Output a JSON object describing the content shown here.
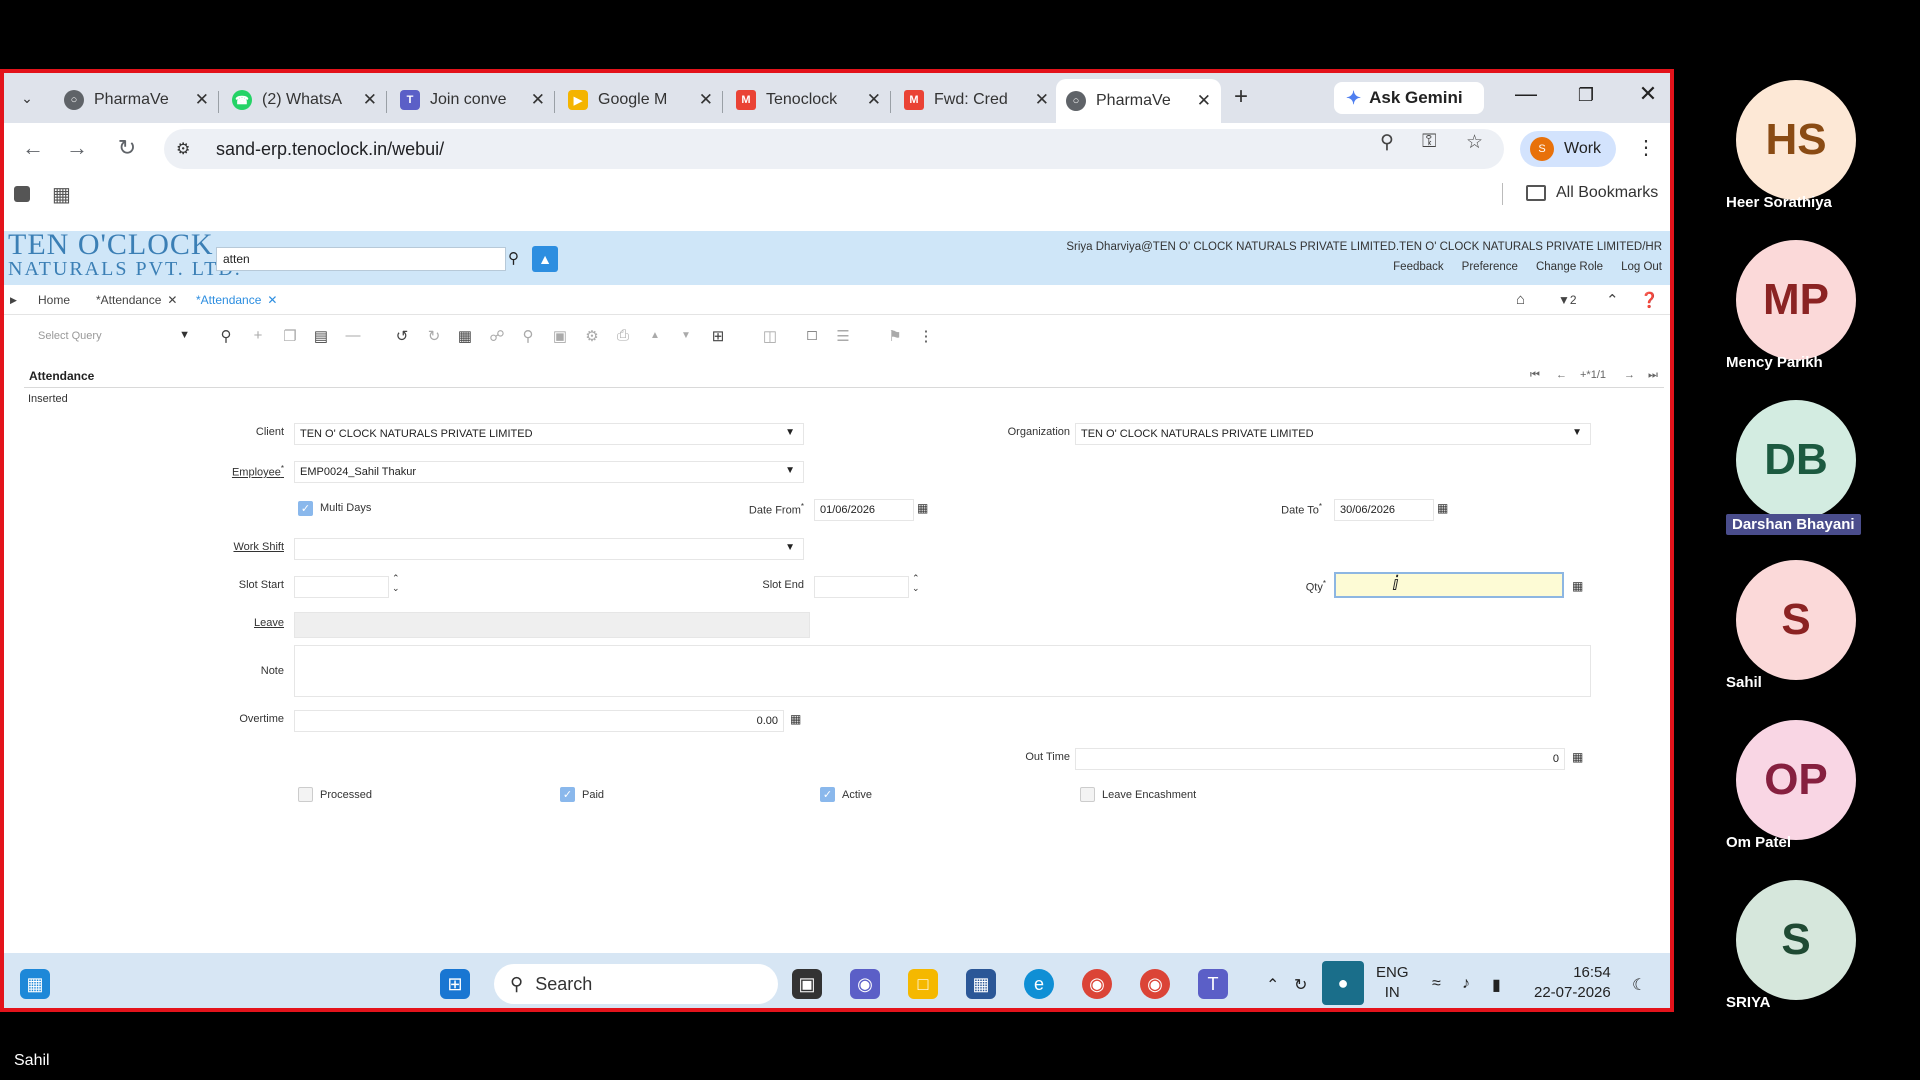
{
  "browser": {
    "tabs": [
      {
        "label": "PharmaVe",
        "icon": "globe-icon",
        "color": "#5f6368",
        "active": false
      },
      {
        "label": "(2) WhatsA",
        "icon": "whatsapp-icon",
        "color": "#25d366",
        "active": false
      },
      {
        "label": "Join conve",
        "icon": "teams-icon",
        "color": "#5b5fc7",
        "active": false
      },
      {
        "label": "Google M",
        "icon": "meet-icon",
        "color": "#f4b400",
        "active": false
      },
      {
        "label": "Tenoclock",
        "icon": "gmail-icon",
        "color": "#ea4335",
        "active": false
      },
      {
        "label": "Fwd: Cred",
        "icon": "gmail-icon",
        "color": "#ea4335",
        "active": false
      },
      {
        "label": "PharmaVe",
        "icon": "globe-icon",
        "color": "#5f6368",
        "active": true
      }
    ],
    "new_tab": "+",
    "gemini_label": "Ask Gemini",
    "url": "sand-erp.tenoclock.in/webui/",
    "profile_label": "Work",
    "profile_initial": "S",
    "all_bookmarks": "All Bookmarks"
  },
  "erp": {
    "logo_line1": "TEN O'CLOCK",
    "logo_line2": "NATURALS PVT. LTD.",
    "search_value": "atten",
    "user_info": "Sriya Dharviya@TEN O' CLOCK NATURALS PRIVATE LIMITED.TEN O' CLOCK NATURALS PRIVATE LIMITED/HR",
    "links": [
      "Feedback",
      "Preference",
      "Change Role",
      "Log Out"
    ],
    "tabs": [
      "Home",
      "*Attendance",
      "*Attendance"
    ],
    "notif_count": "2",
    "select_query_placeholder": "Select Query",
    "form_title": "Attendance",
    "record_nav": "+*1/1",
    "status": "Inserted",
    "form": {
      "client_label": "Client",
      "client_value": "TEN O' CLOCK NATURALS PRIVATE LIMITED",
      "org_label": "Organization",
      "org_value": "TEN O' CLOCK NATURALS PRIVATE LIMITED",
      "employee_label": "Employee",
      "employee_value": "EMP0024_Sahil Thakur",
      "multi_days_label": "Multi Days",
      "multi_days": true,
      "date_from_label": "Date From",
      "date_from_value": "01/06/2026",
      "date_to_label": "Date To",
      "date_to_value": "30/06/2026",
      "work_shift_label": "Work Shift",
      "work_shift_value": "",
      "slot_start_label": "Slot Start",
      "slot_end_label": "Slot End",
      "qty_label": "Qty",
      "qty_value": "",
      "leave_label": "Leave",
      "note_label": "Note",
      "overtime_label": "Overtime",
      "overtime_value": "0.00",
      "out_time_label": "Out Time",
      "out_time_value": "0",
      "processed_label": "Processed",
      "processed": false,
      "paid_label": "Paid",
      "paid": true,
      "active_label": "Active",
      "active": true,
      "leave_encashment_label": "Leave Encashment",
      "leave_encashment": false
    }
  },
  "taskbar": {
    "search_label": "Search",
    "lang_line1": "ENG",
    "lang_line2": "IN",
    "time": "16:54",
    "date": "22-07-2026"
  },
  "participants": [
    {
      "initials": "HS",
      "name": "Heer Sorathiya",
      "bg": "#fde8d6",
      "fg": "#8a4b14",
      "highlight": false
    },
    {
      "initials": "MP",
      "name": "Mency Parikh",
      "bg": "#fbd9d9",
      "fg": "#8b2323",
      "highlight": false
    },
    {
      "initials": "DB",
      "name": "Darshan Bhayani",
      "bg": "#d3ece1",
      "fg": "#1c5a40",
      "highlight": true
    },
    {
      "initials": "S",
      "name": "Sahil",
      "bg": "#fbd9d9",
      "fg": "#8b2323",
      "highlight": false
    },
    {
      "initials": "OP",
      "name": "Om Patel",
      "bg": "#f9d6e4",
      "fg": "#86203f",
      "highlight": false
    },
    {
      "initials": "S",
      "name": "SRIYA",
      "bg": "#d6e7dc",
      "fg": "#1f4a33",
      "highlight": false
    }
  ],
  "bottom_name": "Sahil"
}
